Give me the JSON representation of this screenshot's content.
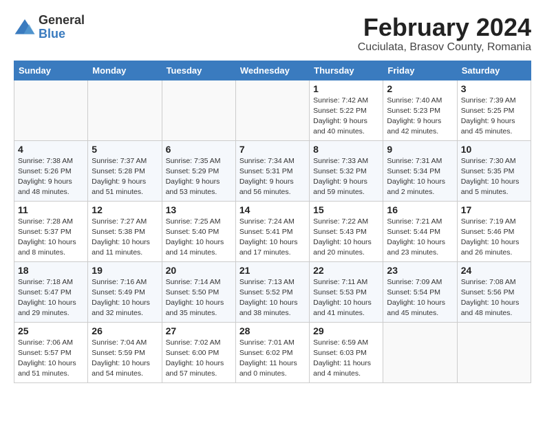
{
  "logo": {
    "general": "General",
    "blue": "Blue"
  },
  "title": {
    "month_year": "February 2024",
    "location": "Cuciulata, Brasov County, Romania"
  },
  "days_of_week": [
    "Sunday",
    "Monday",
    "Tuesday",
    "Wednesday",
    "Thursday",
    "Friday",
    "Saturday"
  ],
  "weeks": [
    [
      {
        "day": "",
        "info": ""
      },
      {
        "day": "",
        "info": ""
      },
      {
        "day": "",
        "info": ""
      },
      {
        "day": "",
        "info": ""
      },
      {
        "day": "1",
        "info": "Sunrise: 7:42 AM\nSunset: 5:22 PM\nDaylight: 9 hours\nand 40 minutes."
      },
      {
        "day": "2",
        "info": "Sunrise: 7:40 AM\nSunset: 5:23 PM\nDaylight: 9 hours\nand 42 minutes."
      },
      {
        "day": "3",
        "info": "Sunrise: 7:39 AM\nSunset: 5:25 PM\nDaylight: 9 hours\nand 45 minutes."
      }
    ],
    [
      {
        "day": "4",
        "info": "Sunrise: 7:38 AM\nSunset: 5:26 PM\nDaylight: 9 hours\nand 48 minutes."
      },
      {
        "day": "5",
        "info": "Sunrise: 7:37 AM\nSunset: 5:28 PM\nDaylight: 9 hours\nand 51 minutes."
      },
      {
        "day": "6",
        "info": "Sunrise: 7:35 AM\nSunset: 5:29 PM\nDaylight: 9 hours\nand 53 minutes."
      },
      {
        "day": "7",
        "info": "Sunrise: 7:34 AM\nSunset: 5:31 PM\nDaylight: 9 hours\nand 56 minutes."
      },
      {
        "day": "8",
        "info": "Sunrise: 7:33 AM\nSunset: 5:32 PM\nDaylight: 9 hours\nand 59 minutes."
      },
      {
        "day": "9",
        "info": "Sunrise: 7:31 AM\nSunset: 5:34 PM\nDaylight: 10 hours\nand 2 minutes."
      },
      {
        "day": "10",
        "info": "Sunrise: 7:30 AM\nSunset: 5:35 PM\nDaylight: 10 hours\nand 5 minutes."
      }
    ],
    [
      {
        "day": "11",
        "info": "Sunrise: 7:28 AM\nSunset: 5:37 PM\nDaylight: 10 hours\nand 8 minutes."
      },
      {
        "day": "12",
        "info": "Sunrise: 7:27 AM\nSunset: 5:38 PM\nDaylight: 10 hours\nand 11 minutes."
      },
      {
        "day": "13",
        "info": "Sunrise: 7:25 AM\nSunset: 5:40 PM\nDaylight: 10 hours\nand 14 minutes."
      },
      {
        "day": "14",
        "info": "Sunrise: 7:24 AM\nSunset: 5:41 PM\nDaylight: 10 hours\nand 17 minutes."
      },
      {
        "day": "15",
        "info": "Sunrise: 7:22 AM\nSunset: 5:43 PM\nDaylight: 10 hours\nand 20 minutes."
      },
      {
        "day": "16",
        "info": "Sunrise: 7:21 AM\nSunset: 5:44 PM\nDaylight: 10 hours\nand 23 minutes."
      },
      {
        "day": "17",
        "info": "Sunrise: 7:19 AM\nSunset: 5:46 PM\nDaylight: 10 hours\nand 26 minutes."
      }
    ],
    [
      {
        "day": "18",
        "info": "Sunrise: 7:18 AM\nSunset: 5:47 PM\nDaylight: 10 hours\nand 29 minutes."
      },
      {
        "day": "19",
        "info": "Sunrise: 7:16 AM\nSunset: 5:49 PM\nDaylight: 10 hours\nand 32 minutes."
      },
      {
        "day": "20",
        "info": "Sunrise: 7:14 AM\nSunset: 5:50 PM\nDaylight: 10 hours\nand 35 minutes."
      },
      {
        "day": "21",
        "info": "Sunrise: 7:13 AM\nSunset: 5:52 PM\nDaylight: 10 hours\nand 38 minutes."
      },
      {
        "day": "22",
        "info": "Sunrise: 7:11 AM\nSunset: 5:53 PM\nDaylight: 10 hours\nand 41 minutes."
      },
      {
        "day": "23",
        "info": "Sunrise: 7:09 AM\nSunset: 5:54 PM\nDaylight: 10 hours\nand 45 minutes."
      },
      {
        "day": "24",
        "info": "Sunrise: 7:08 AM\nSunset: 5:56 PM\nDaylight: 10 hours\nand 48 minutes."
      }
    ],
    [
      {
        "day": "25",
        "info": "Sunrise: 7:06 AM\nSunset: 5:57 PM\nDaylight: 10 hours\nand 51 minutes."
      },
      {
        "day": "26",
        "info": "Sunrise: 7:04 AM\nSunset: 5:59 PM\nDaylight: 10 hours\nand 54 minutes."
      },
      {
        "day": "27",
        "info": "Sunrise: 7:02 AM\nSunset: 6:00 PM\nDaylight: 10 hours\nand 57 minutes."
      },
      {
        "day": "28",
        "info": "Sunrise: 7:01 AM\nSunset: 6:02 PM\nDaylight: 11 hours\nand 0 minutes."
      },
      {
        "day": "29",
        "info": "Sunrise: 6:59 AM\nSunset: 6:03 PM\nDaylight: 11 hours\nand 4 minutes."
      },
      {
        "day": "",
        "info": ""
      },
      {
        "day": "",
        "info": ""
      }
    ]
  ]
}
